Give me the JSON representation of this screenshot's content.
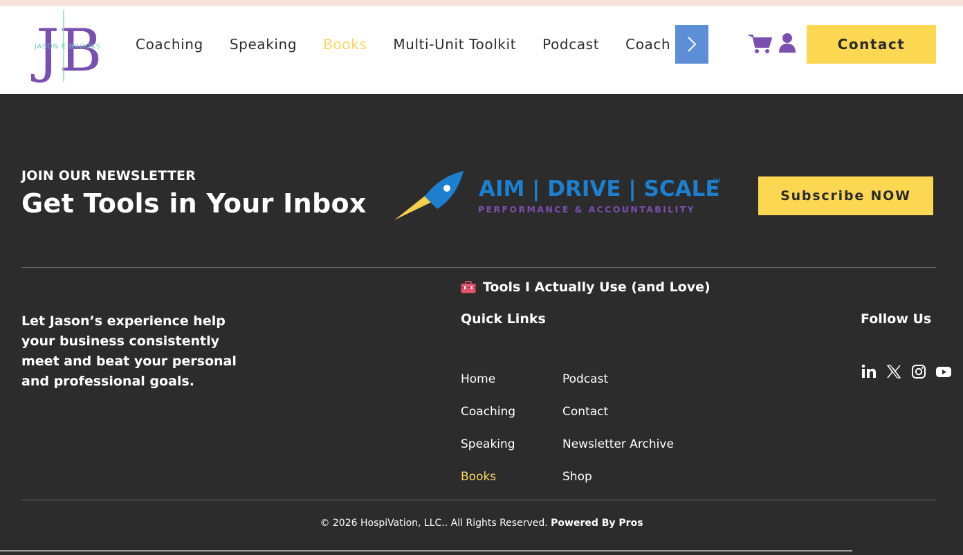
{
  "header": {
    "logo_monogram": "JB",
    "logo_name": "JASON E BROOKS",
    "nav": [
      {
        "label": "Coaching",
        "active": false
      },
      {
        "label": "Speaking",
        "active": false
      },
      {
        "label": "Books",
        "active": true
      },
      {
        "label": "Multi-Unit Toolkit",
        "active": false
      },
      {
        "label": "Podcast",
        "active": false
      },
      {
        "label": "Coach Up",
        "active": false
      }
    ],
    "next_icon": "chevron-right-icon",
    "cart_icon": "cart-icon",
    "user_icon": "user-icon",
    "contact_label": "Contact"
  },
  "newsletter": {
    "kicker": "JOIN OUR NEWSLETTER",
    "title": "Get Tools in Your Inbox",
    "brand_logo_text": "AIM | DRIVE | SCALE",
    "brand_logo_tm": "TM",
    "brand_logo_sub": "PERFORMANCE & ACCOUNTABILITY",
    "subscribe_label": "Subscribe NOW"
  },
  "footer": {
    "tools_line": "Tools I Actually Use (and Love)",
    "tagline": "Let Jason’s experience help your business consistently meet and beat your personal and professional goals.",
    "quick_links_title": "Quick Links",
    "quick_links_col1": [
      {
        "label": "Home",
        "active": false
      },
      {
        "label": "Coaching",
        "active": false
      },
      {
        "label": "Speaking",
        "active": false
      },
      {
        "label": "Books",
        "active": true
      }
    ],
    "quick_links_col2": [
      {
        "label": "Podcast",
        "active": false
      },
      {
        "label": "Contact",
        "active": false
      },
      {
        "label": "Newsletter Archive",
        "active": false
      },
      {
        "label": "Shop",
        "active": false
      }
    ],
    "follow_title": "Follow Us",
    "social_icons": [
      "linkedin-icon",
      "x-icon",
      "instagram-icon",
      "youtube-icon"
    ],
    "copyright": "© 2026 HospiVation, LLC.. All Rights Reserved.",
    "powered_by": "Powered By Pros"
  },
  "colors": {
    "accent_yellow": "#fcd852",
    "active_link": "#f6d860",
    "footer_bg": "#2c2c2c",
    "brand_purple": "#7a4fb0",
    "brand_blue": "#1c7fd0",
    "arrow_blue": "#5c8fd6"
  }
}
